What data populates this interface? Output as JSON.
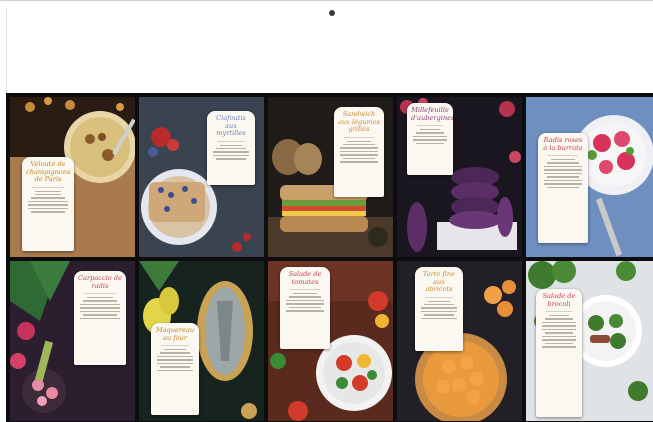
{
  "device": {
    "camera": "front-camera-dot",
    "bezel_color": "#ffffff",
    "screen_color": "#0d0d0d"
  },
  "gallery": {
    "tiles": [
      {
        "name": "soup-bowl-recipe-card",
        "title": "Velouté de champignons de Paris",
        "accent": "#c7851e"
      },
      {
        "name": "blueberry-cake-recipe-card",
        "title": "Clafoutis aux myrtilles",
        "accent": "#6f7fb0"
      },
      {
        "name": "veggie-sandwich-recipe-card",
        "title": "Sandwich aux légumes grillés",
        "accent": "#d08a32"
      },
      {
        "name": "eggplant-tower-recipe-card",
        "title": "Millefeuille d'aubergines",
        "accent": "#8c3f78"
      },
      {
        "name": "radish-salad-recipe-card",
        "title": "Radis roses à la burrata",
        "accent": "#c43f57"
      },
      {
        "name": "radish-bunch-recipe-card",
        "title": "Carpaccio de radis",
        "accent": "#c43f57"
      },
      {
        "name": "fish-pear-recipe-card",
        "title": "Maquereau au four",
        "accent": "#c7851e"
      },
      {
        "name": "tomato-salad-recipe-card",
        "title": "Salade de tomates",
        "accent": "#c43f57"
      },
      {
        "name": "apricot-tart-recipe-card",
        "title": "Tarte fine aux abricots",
        "accent": "#d08a32"
      },
      {
        "name": "broccoli-bowl-recipe-card",
        "title": "Salade de brocoli",
        "accent": "#c43f57"
      }
    ]
  }
}
